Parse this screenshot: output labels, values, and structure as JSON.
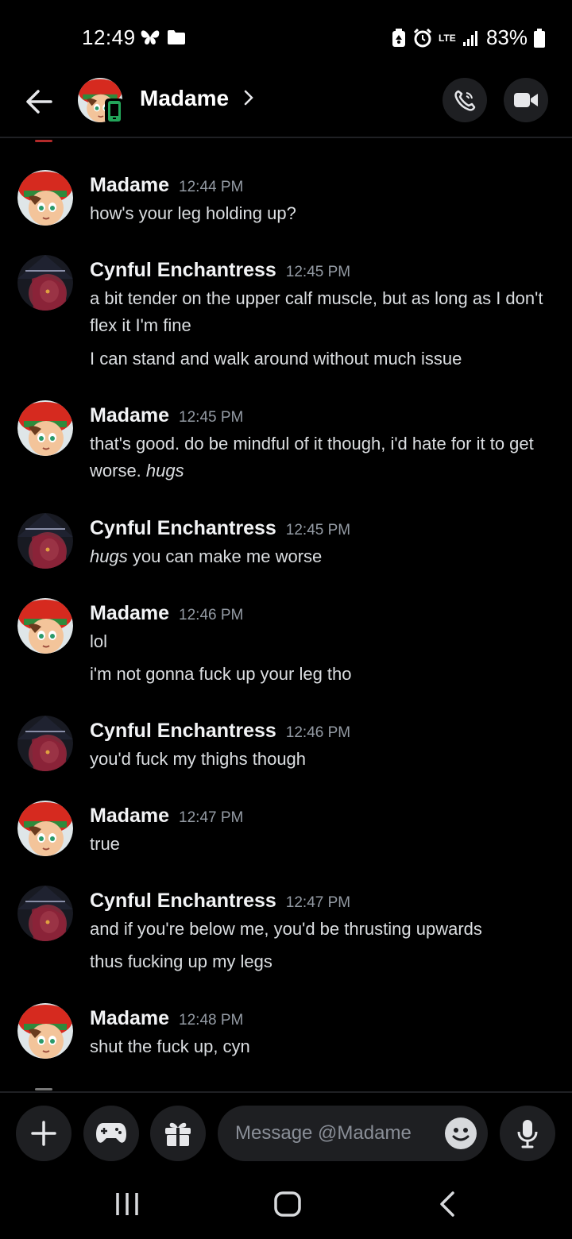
{
  "status_bar": {
    "time": "12:49",
    "battery": "83%",
    "network": "LTE"
  },
  "header": {
    "title": "Madame",
    "chevron": "›"
  },
  "messages": [
    {
      "author": "Madame",
      "time": "12:44 PM",
      "avatar": "madame",
      "lines": [
        "how's your leg holding up?"
      ]
    },
    {
      "author": "Cynful Enchantress",
      "time": "12:45 PM",
      "avatar": "cynful",
      "lines": [
        "a bit tender on the upper calf muscle, but as long as I don't flex it I'm fine",
        "I can stand and walk around without much issue"
      ]
    },
    {
      "author": "Madame",
      "time": "12:45 PM",
      "avatar": "madame",
      "lines": [
        "that's good. do be mindful of it though, i'd hate for it to get worse."
      ],
      "italic": "hugs"
    },
    {
      "author": "Cynful Enchantress",
      "time": "12:45 PM",
      "avatar": "cynful",
      "italic_lead": "hugs",
      "lines": [
        " you can make me worse"
      ]
    },
    {
      "author": "Madame",
      "time": "12:46 PM",
      "avatar": "madame",
      "lines": [
        "lol",
        "i'm not gonna fuck up your leg tho"
      ]
    },
    {
      "author": "Cynful Enchantress",
      "time": "12:46 PM",
      "avatar": "cynful",
      "lines": [
        "you'd fuck my thighs though"
      ]
    },
    {
      "author": "Madame",
      "time": "12:47 PM",
      "avatar": "madame",
      "lines": [
        "true"
      ]
    },
    {
      "author": "Cynful Enchantress",
      "time": "12:47 PM",
      "avatar": "cynful",
      "lines": [
        "and if you're below me, you'd be thrusting upwards",
        "thus fucking up my legs"
      ]
    },
    {
      "author": "Madame",
      "time": "12:48 PM",
      "avatar": "madame",
      "lines": [
        "shut the fuck up, cyn"
      ]
    }
  ],
  "composer": {
    "placeholder": "Message @Madame"
  },
  "colors": {
    "background": "#000000",
    "surface": "#1e1f22",
    "timestamp": "#949ba4",
    "text": "#dbdee1"
  }
}
